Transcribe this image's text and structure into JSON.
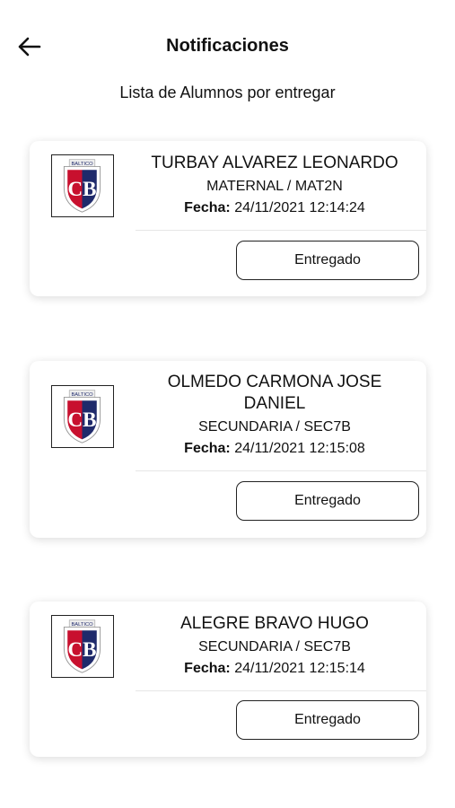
{
  "header": {
    "title": "Notificaciones",
    "back_icon": "arrow-left-icon"
  },
  "subtitle": "Lista de Alumnos por entregar",
  "students": [
    {
      "name": "TURBAY ALVAREZ LEONARDO",
      "level": "MATERNAL / MAT2N",
      "date_label": "Fecha:",
      "date_value": "24/11/2021 12:14:24",
      "button_label": "Entregado"
    },
    {
      "name": "OLMEDO CARMONA JOSE DANIEL",
      "level": "SECUNDARIA / SEC7B",
      "date_label": "Fecha:",
      "date_value": "24/11/2021 12:15:08",
      "button_label": "Entregado"
    },
    {
      "name": "ALEGRE BRAVO HUGO",
      "level": "SECUNDARIA / SEC7B",
      "date_label": "Fecha:",
      "date_value": "24/11/2021 12:15:14",
      "button_label": "Entregado"
    }
  ],
  "logo": {
    "text_top": "COLEGIO BILINGÜE",
    "text_name": "BALTICO",
    "initials": "CB",
    "colors": {
      "red": "#c8102e",
      "navy": "#1f2a6b"
    }
  }
}
